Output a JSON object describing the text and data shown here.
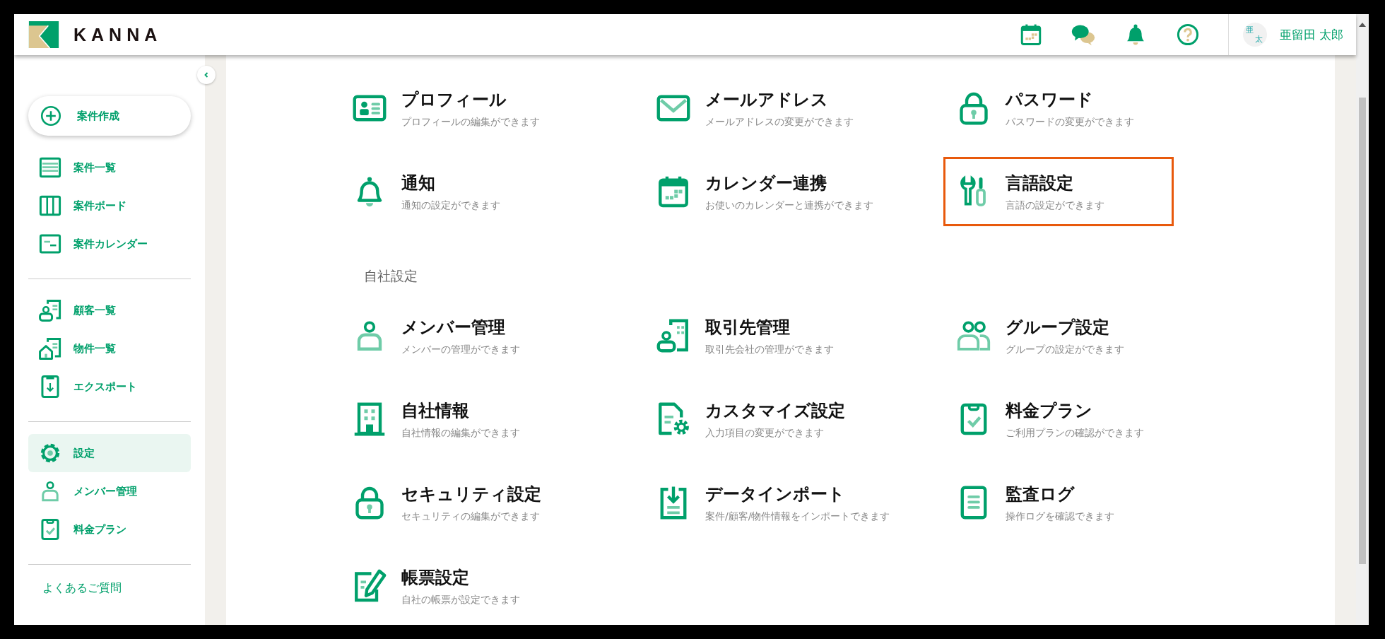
{
  "header": {
    "logo_text": "KANNA",
    "user": {
      "avatar_top": "亜",
      "avatar_bottom": "太",
      "name": "亜留田 太郎"
    }
  },
  "sidebar": {
    "create_button": "案件作成",
    "groups": [
      [
        {
          "label": "案件一覧",
          "kind": "list",
          "selected": false
        },
        {
          "label": "案件ボード",
          "kind": "board",
          "selected": false
        },
        {
          "label": "案件カレンダー",
          "kind": "schedule",
          "selected": false
        }
      ],
      [
        {
          "label": "顧客一覧",
          "kind": "customer",
          "selected": false
        },
        {
          "label": "物件一覧",
          "kind": "property",
          "selected": false
        },
        {
          "label": "エクスポート",
          "kind": "export",
          "selected": false
        }
      ],
      [
        {
          "label": "設定",
          "kind": "settings",
          "selected": true
        },
        {
          "label": "メンバー管理",
          "kind": "member",
          "selected": false
        },
        {
          "label": "料金プラン",
          "kind": "plan",
          "selected": false
        }
      ]
    ],
    "faq_link": "よくあるご質問"
  },
  "sections": [
    {
      "items": [
        {
          "title": "プロフィール",
          "description": "プロフィールの編集ができます",
          "kind": "profile",
          "highlighted": false
        },
        {
          "title": "メールアドレス",
          "description": "メールアドレスの変更ができます",
          "kind": "mail",
          "highlighted": false
        },
        {
          "title": "パスワード",
          "description": "パスワードの変更ができます",
          "kind": "lock",
          "highlighted": false
        },
        {
          "title": "通知",
          "description": "通知の設定ができます",
          "kind": "bell",
          "highlighted": false
        },
        {
          "title": "カレンダー連携",
          "description": "お使いのカレンダーと連携ができます",
          "kind": "calendar",
          "highlighted": false
        },
        {
          "title": "言語設定",
          "description": "言語の設定ができます",
          "kind": "tools",
          "highlighted": true
        }
      ]
    },
    {
      "heading": "自社設定",
      "items": [
        {
          "title": "メンバー管理",
          "description": "メンバーの管理ができます",
          "kind": "member",
          "highlighted": false
        },
        {
          "title": "取引先管理",
          "description": "取引先会社の管理ができます",
          "kind": "partner",
          "highlighted": false
        },
        {
          "title": "グループ設定",
          "description": "グループの設定ができます",
          "kind": "group",
          "highlighted": false
        },
        {
          "title": "自社情報",
          "description": "自社情報の編集ができます",
          "kind": "building",
          "highlighted": false
        },
        {
          "title": "カスタマイズ設定",
          "description": "入力項目の変更ができます",
          "kind": "customize",
          "highlighted": false
        },
        {
          "title": "料金プラン",
          "description": "ご利用プランの確認ができます",
          "kind": "plan",
          "highlighted": false
        },
        {
          "title": "セキュリティ設定",
          "description": "セキュリティの編集ができます",
          "kind": "lock",
          "highlighted": false
        },
        {
          "title": "データインポート",
          "description": "案件/顧客/物件情報をインポートできます",
          "kind": "import",
          "highlighted": false
        },
        {
          "title": "監査ログ",
          "description": "操作ログを確認できます",
          "kind": "log",
          "highlighted": false
        },
        {
          "title": "帳票設定",
          "description": "自社の帳票が設定できます",
          "kind": "form",
          "highlighted": false
        }
      ]
    }
  ]
}
